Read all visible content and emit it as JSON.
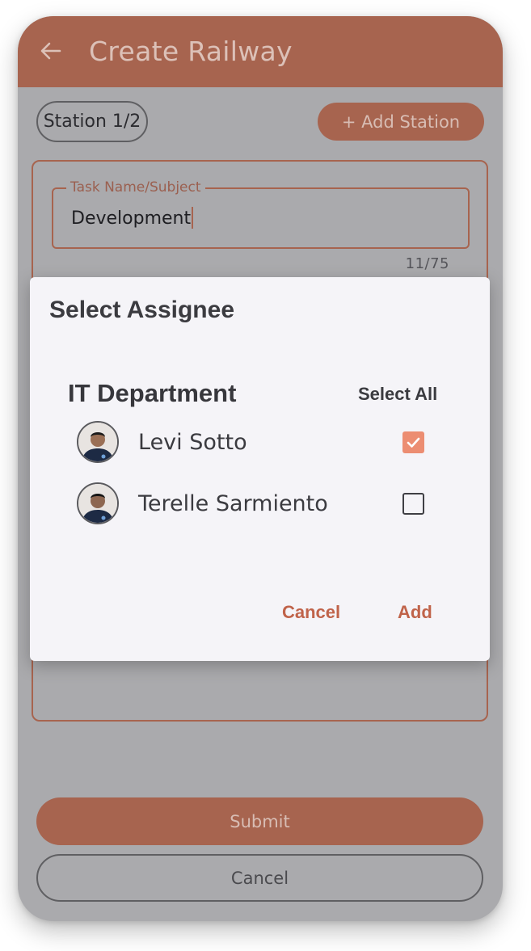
{
  "header": {
    "title": "Create Railway",
    "back_icon": "arrow-left-icon"
  },
  "station": {
    "chip_label": "Station 1/2",
    "add_label": "+ Add Station"
  },
  "task_field": {
    "label": "Task Name/Subject",
    "value": "Development",
    "char_count": "11/75"
  },
  "footer": {
    "submit_label": "Submit",
    "cancel_label": "Cancel"
  },
  "dialog": {
    "title": "Select Assignee",
    "department": "IT Department",
    "select_all_label": "Select All",
    "assignees": [
      {
        "name": "Levi Sotto",
        "checked": true,
        "avatar_icon": "user-photo-avatar"
      },
      {
        "name": "Terelle Sarmiento",
        "checked": false,
        "avatar_icon": "user-photo-avatar"
      }
    ],
    "cancel_label": "Cancel",
    "add_label": "Add"
  },
  "colors": {
    "accent": "#c0634a",
    "checkbox_checked": "#ec8d72",
    "header_dimmed": "#a7644f",
    "overlay": "#aaaaad"
  }
}
